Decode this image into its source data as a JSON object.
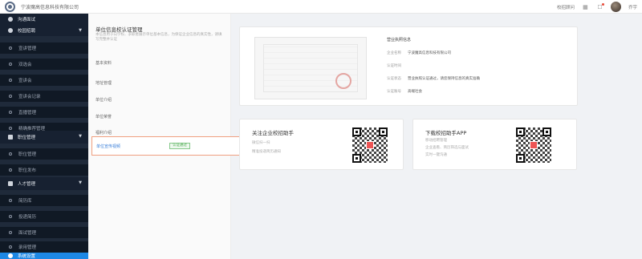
{
  "header": {
    "company": "宁波魔高信息科技有限公司",
    "links": [
      "校招顾问"
    ],
    "user": "乔宇"
  },
  "sidebar": {
    "items": [
      {
        "label": "沟通面试",
        "kind": "group"
      },
      {
        "label": "校园招聘",
        "kind": "group"
      },
      {
        "label": "宣讲管理",
        "kind": "sub"
      },
      {
        "label": "双选会",
        "kind": "sub"
      },
      {
        "label": "宣讲会",
        "kind": "sub"
      },
      {
        "label": "宣讲会记录",
        "kind": "sub"
      },
      {
        "label": "直播管理",
        "kind": "sub"
      },
      {
        "label": "精确推荐管理",
        "kind": "sub"
      },
      {
        "label": "职位管理",
        "kind": "group"
      },
      {
        "label": "职位管理",
        "kind": "sub"
      },
      {
        "label": "职位发布",
        "kind": "sub"
      },
      {
        "label": "人才管理",
        "kind": "group"
      },
      {
        "label": "简历库",
        "kind": "sub"
      },
      {
        "label": "投递简历",
        "kind": "sub"
      },
      {
        "label": "面试管理",
        "kind": "sub"
      },
      {
        "label": "录用管理",
        "kind": "sub"
      },
      {
        "label": "系统设置",
        "kind": "active"
      }
    ]
  },
  "panel": {
    "title": "单位信息校认证管理",
    "description": "本信息用于向学校、求职者展示单位基本信息，为保证企业信息的真实性，请填写完整并认证",
    "links": [
      "基本资料",
      "地址管理",
      "单位介绍",
      "单位荣誉",
      "福利介绍"
    ],
    "highlight_link": "单位宣传视频",
    "highlight_badge": "认证通过"
  },
  "cert": {
    "title": "营业执照信息",
    "rows": [
      {
        "label": "企业名称",
        "value": "宁波魔高信息科技有限公司"
      },
      {
        "label": "认证时间",
        "value": ""
      },
      {
        "label": "认证状态",
        "value": "营业执照认证通过，请您保持信息的真实准确"
      },
      {
        "label": "认证账号",
        "value": "高端社会"
      }
    ]
  },
  "qr_cards": [
    {
      "title": "关注企业校招助手",
      "lines": [
        "微信扫一扫",
        "精准投递简历通知"
      ]
    },
    {
      "title": "下载校招助手APP",
      "lines": [
        "移动招聘管理",
        "企业查看、简历筛选与面试",
        "实时一键沟通"
      ]
    }
  ]
}
